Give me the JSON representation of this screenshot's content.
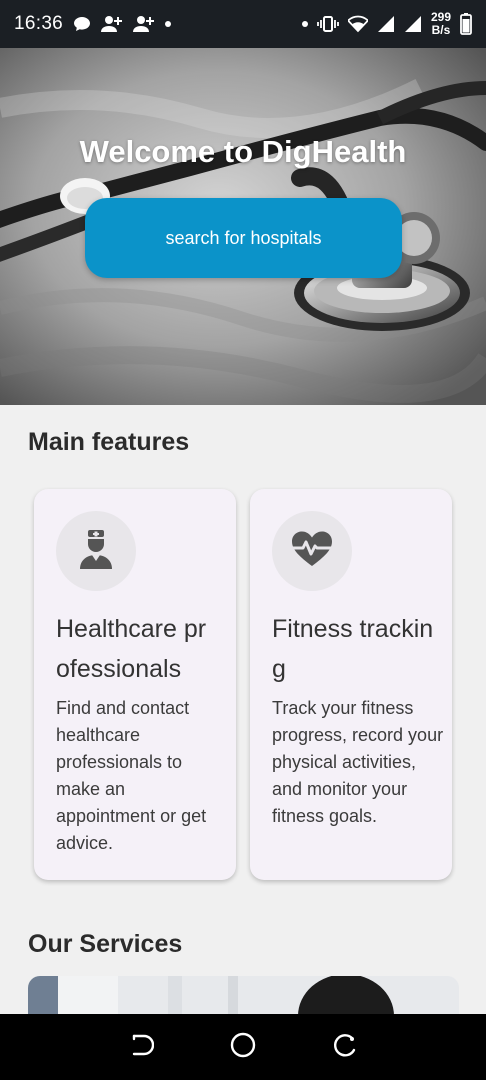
{
  "status_bar": {
    "time": "16:36",
    "net_speed_value": "299",
    "net_speed_unit": "B/s",
    "icons": [
      "message-icon",
      "add-person-icon",
      "add-person-icon",
      "dot-icon",
      "dot-icon",
      "vibrate-icon",
      "wifi-icon",
      "signal-icon",
      "signal-icon",
      "battery-icon"
    ]
  },
  "hero": {
    "title": "Welcome to DigHealth",
    "search_button_label": "search for hospitals"
  },
  "main_features": {
    "heading": "Main features",
    "cards": [
      {
        "icon": "doctor-icon",
        "title": "Healthcare professionals",
        "description": "Find and contact healthcare professionals to make an appointment or get advice."
      },
      {
        "icon": "heartbeat-icon",
        "title": "Fitness tracking",
        "description": "Track your fitness progress, record your physical activities, and monitor your fitness goals."
      }
    ]
  },
  "our_services": {
    "heading": "Our Services"
  },
  "nav_bar": {
    "icons": [
      "back-icon",
      "home-icon",
      "recents-icon"
    ]
  },
  "colors": {
    "accent": "#0b93c9",
    "card_background": "#f5f1f8",
    "page_background": "#f0f0f0"
  }
}
